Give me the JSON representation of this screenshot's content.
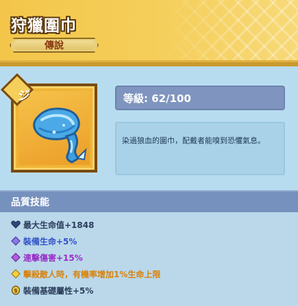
{
  "item": {
    "name": "狩獵圍巾",
    "rarity": "傳說",
    "corner_glyph": "ジ",
    "level_label": "等級: 62/100",
    "description": "染過狼血的圍巾，配戴者能嗅到恐懼氣息。"
  },
  "skills": {
    "title": "品質技能",
    "rows": [
      {
        "text": "最大生命值+1848",
        "color": "#2c3e5c",
        "icon": "heart-icon"
      },
      {
        "text": "裝備生命+5%",
        "color": "#3452c8",
        "icon": "purple-diamond-icon"
      },
      {
        "text": "連擊傷害+15%",
        "color": "#9a2fc9",
        "icon": "violet-diamond-icon"
      },
      {
        "text": "擊殺敵人時，有機率增加1%生命上限",
        "color": "#d9820a",
        "icon": "gold-diamond-icon"
      },
      {
        "text": "裝備基礎屬性+5%",
        "color": "#2c3e5c",
        "icon": "coin-icon"
      }
    ]
  },
  "colors": {
    "header_gold": "#f3c64a",
    "panel_blue": "#7f95bf",
    "background": "#b8dcef"
  }
}
